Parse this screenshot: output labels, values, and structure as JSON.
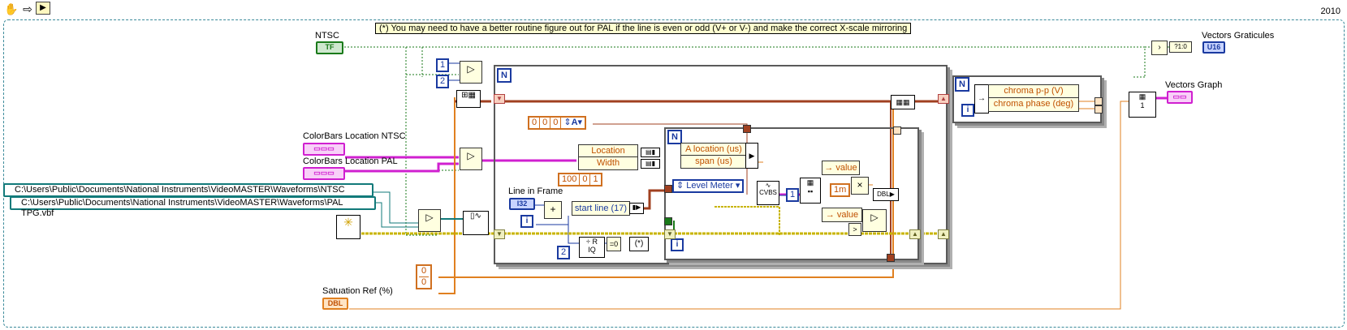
{
  "toolbar": {
    "hand_icon": "hand-icon",
    "arrow_icon": "arrow-icon",
    "frame_icon": "frame-icon",
    "year": "2010"
  },
  "note": "(*) You may need to have a better routine figure out for PAL if the line is even or odd (V+ or V-) and make the correct X-scale mirroring",
  "controls": {
    "ntsc": {
      "label": "NTSC",
      "tag": "TF"
    },
    "colorbars_ntsc": {
      "label": "ColorBars Location NTSC"
    },
    "colorbars_pal": {
      "label": "ColorBars Location PAL"
    },
    "path_ntsc": "C:\\Users\\Public\\Documents\\National Instruments\\VideoMASTER\\Waveforms\\NTSC TPG.vbf",
    "path_pal": "C:\\Users\\Public\\Documents\\National Instruments\\VideoMASTER\\Waveforms\\PAL TPG.vbf",
    "line_in_frame": {
      "label": "Line in Frame",
      "tag": "I32"
    },
    "saturation_ref": {
      "label": "Satuation Ref (%)",
      "tag": "DBL"
    }
  },
  "indicators": {
    "vectors_graticules": {
      "label": "Vectors Graticules",
      "tag": "U16"
    },
    "vectors_graph": {
      "label": "Vectors Graph"
    }
  },
  "constants": {
    "one": "1",
    "two": "2",
    "one_b": "1",
    "two_b": "2",
    "zero_a": "0",
    "zero_b": "0",
    "enum_vals": [
      "0",
      "0",
      "0"
    ],
    "enum_sel": "A",
    "arr_100": [
      "100",
      "0",
      "1"
    ],
    "one_m": "1m",
    "one_c": "1",
    "paren_star": "(*)"
  },
  "bundles": {
    "loc_width": [
      "Location",
      "Width"
    ],
    "a_loc_span": [
      "A location (us)",
      "span (us)"
    ],
    "start_line": "start line (17)",
    "chroma": [
      "chroma p-p (V)",
      "chroma phase (deg)"
    ],
    "value_a": "value",
    "value_b": "value",
    "level_meter": "Level Meter"
  },
  "loops": {
    "n": "N",
    "i": "i"
  },
  "colors": {
    "boolean_wire": "#1a7a1a",
    "cluster_wire": "#d020d0",
    "numeric_wire_blue": "#1a3aa0",
    "numeric_wire_orange": "#e08020",
    "path_wire": "#127a7a",
    "enum_wire": "#a04020",
    "waveform_wire": "#c8b400"
  }
}
